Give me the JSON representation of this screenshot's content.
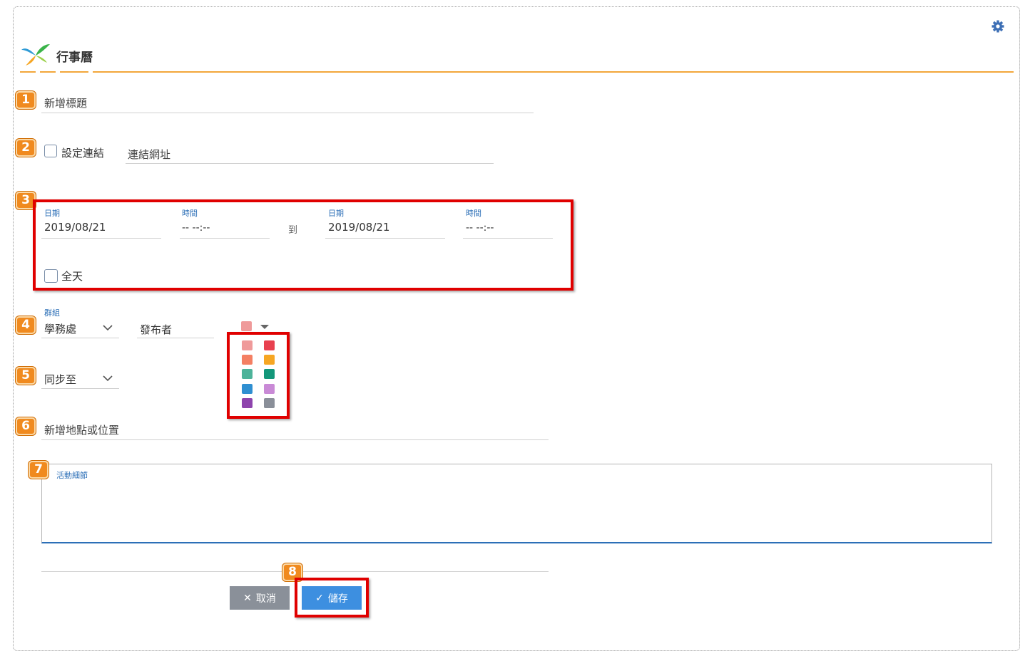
{
  "app": {
    "title": "行事曆"
  },
  "badges": [
    "1",
    "2",
    "3",
    "4",
    "5",
    "6",
    "7",
    "8"
  ],
  "title_field": {
    "placeholder": "新增標題"
  },
  "link": {
    "checkbox_label": "設定連結",
    "url_placeholder": "連結網址"
  },
  "datetime": {
    "start_date_label": "日期",
    "start_date": "2019/08/21",
    "start_time_label": "時間",
    "start_time": "-- --:--",
    "to": "到",
    "end_date_label": "日期",
    "end_date": "2019/08/21",
    "end_time_label": "時間",
    "end_time": "-- --:--",
    "all_day_label": "全天"
  },
  "group": {
    "label": "群組",
    "value": "學務處",
    "publisher": "發布者"
  },
  "sync": {
    "value": "同步至"
  },
  "location": {
    "placeholder": "新增地點或位置"
  },
  "details": {
    "label": "活動細節"
  },
  "colors": {
    "selected": "#ef9a9a",
    "palette": [
      "#ef9a9a",
      "#e8414f",
      "#f47f63",
      "#f6a623",
      "#4db39a",
      "#13977a",
      "#2f8fd1",
      "#c98ad6",
      "#8e44ad",
      "#8a8f99"
    ],
    "accent": "#f3a73a",
    "badge": "#f08a1f",
    "highlight": "#e00000"
  },
  "buttons": {
    "cancel": "取消",
    "save": "儲存"
  }
}
